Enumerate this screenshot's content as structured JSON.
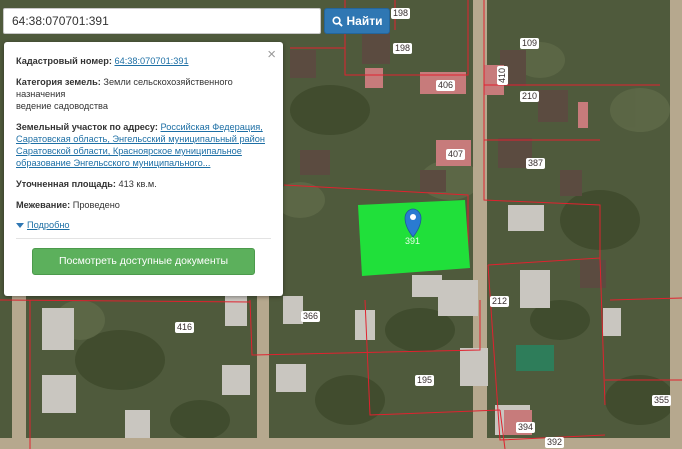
{
  "search": {
    "value": "64:38:070701:391",
    "button_label": "Найти",
    "button_icon": "search-icon"
  },
  "popup": {
    "cadastral_label": "Кадастровый номер:",
    "cadastral_value": "64:38:070701:391",
    "category_label": "Категория земель:",
    "category_value": "Земли сельскохозяйственного назначения",
    "usage_value": "ведение садоводства",
    "address_label": "Земельный участок по адресу:",
    "address_value": "Российская Федерация, Саратовская область, Энгельсский муниципальный район Саратовской области, Красноярское муниципальное образование Энгельсского муниципального...",
    "area_label": "Уточненная площадь:",
    "area_value": "413 кв.м.",
    "survey_label": "Межевание:",
    "survey_value": "Проведено",
    "details_label": "Подробно",
    "docs_button": "Посмотреть доступные документы",
    "close_label": "×"
  },
  "map": {
    "parcel_labels": [
      "198",
      "198",
      "109",
      "406",
      "410",
      "210",
      "407",
      "387",
      "391",
      "212",
      "416",
      "366",
      "195",
      "394",
      "392",
      "355"
    ],
    "highlight_color": "#1ee83a",
    "boundary_color": "#e0222f",
    "marker_color": "#2a7bd1"
  }
}
